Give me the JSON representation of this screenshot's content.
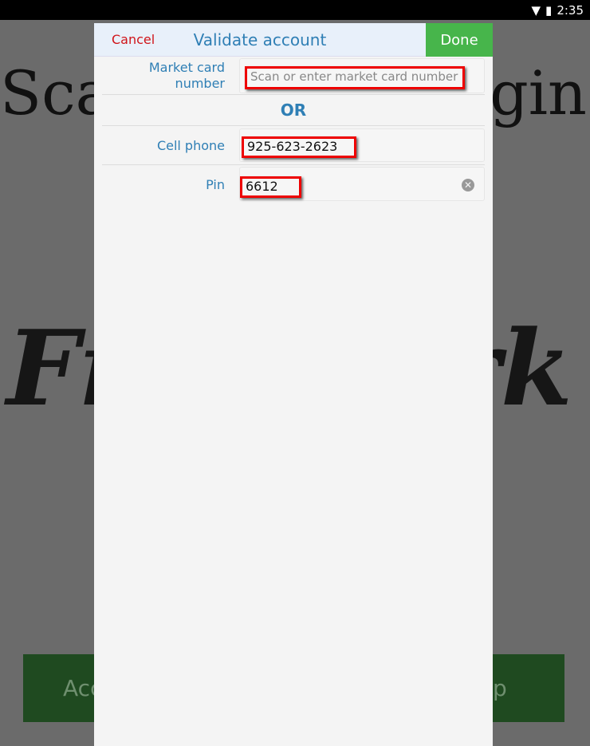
{
  "status_bar": {
    "time": "2:35",
    "icons": [
      "wifi-icon",
      "signal-icon",
      "battery-icon"
    ]
  },
  "background": {
    "heading_left": "Sca",
    "heading_right": "gin",
    "logo_left": "Fr",
    "logo_right": "ork",
    "button_left": "Acc",
    "button_right": "p",
    "button_color": "#1f4a20"
  },
  "dialog": {
    "cancel_label": "Cancel",
    "title": "Validate account",
    "done_label": "Done",
    "market_card": {
      "label": "Market card number",
      "placeholder": "Scan or enter market card number",
      "value": ""
    },
    "or_label": "OR",
    "cell_phone": {
      "label": "Cell phone",
      "value": "925-623-2623"
    },
    "pin": {
      "label": "Pin",
      "value": "6612"
    }
  },
  "colors": {
    "accent": "#2f7fb5",
    "done": "#47b54b",
    "cancel": "#d0141a",
    "highlight": "#e00000"
  }
}
